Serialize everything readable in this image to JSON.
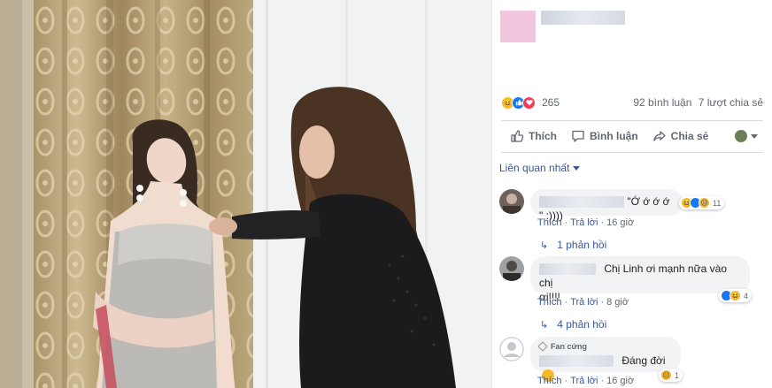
{
  "photo": {
    "description_icon": "photo-icon"
  },
  "post": {
    "reaction_count": "265",
    "comments_count": "92 bình luận",
    "shares_count": "7 lượt chia sẻ",
    "reaction_icons": [
      "haha-icon",
      "like-icon",
      "love-icon"
    ]
  },
  "actions": {
    "like": "Thích",
    "comment": "Bình luận",
    "share": "Chia sẻ"
  },
  "sort_label": "Liên quan nhất",
  "comments": [
    {
      "text": "\"Ớ ớ ớ ớ \" :))))",
      "like_label": "Thích",
      "reply_label": "Trả lời",
      "time": "16 giờ",
      "reaction_count": "11",
      "replies": "1 phản hồi"
    },
    {
      "text_line1": "Chị Linh ơi mạnh nữa vào chị",
      "text_line2": "ơi!!!!",
      "like_label": "Thích",
      "reply_label": "Trả lời",
      "time": "8 giờ",
      "reaction_count": "4",
      "replies": "4 phản hồi"
    },
    {
      "badge": "Fan cứng",
      "text": "Đáng đời",
      "like_label": "Thích",
      "reply_label": "Trả lời",
      "time": "16 giờ",
      "reaction_count": "1"
    }
  ],
  "colors": {
    "link": "#385898",
    "meta": "#606770",
    "bubble": "#f2f3f5",
    "avatar_placeholder": "#f2c6dc"
  }
}
